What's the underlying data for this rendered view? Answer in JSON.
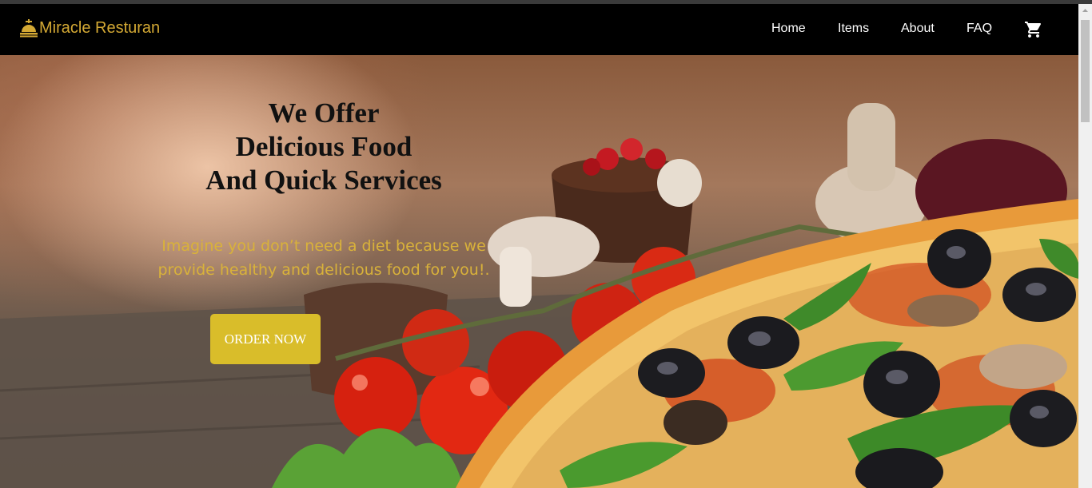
{
  "brand": {
    "name": "Miracle Resturan",
    "logo_icon": "restaurant-cloche-icon",
    "color": "#d4a934"
  },
  "nav": {
    "items": [
      {
        "label": "Home"
      },
      {
        "label": "Items"
      },
      {
        "label": "About"
      },
      {
        "label": "FAQ"
      }
    ],
    "cart_icon": "shopping-cart-icon"
  },
  "hero": {
    "headline": [
      "We Offer",
      "Delicious Food",
      "And Quick Services"
    ],
    "subtext": "Imagine you don’t need a diet because we provide healthy and delicious food for you!.",
    "cta_label": "ORDER NOW",
    "cta_color": "#d9bd2a",
    "subtext_color": "#d9b23a"
  }
}
